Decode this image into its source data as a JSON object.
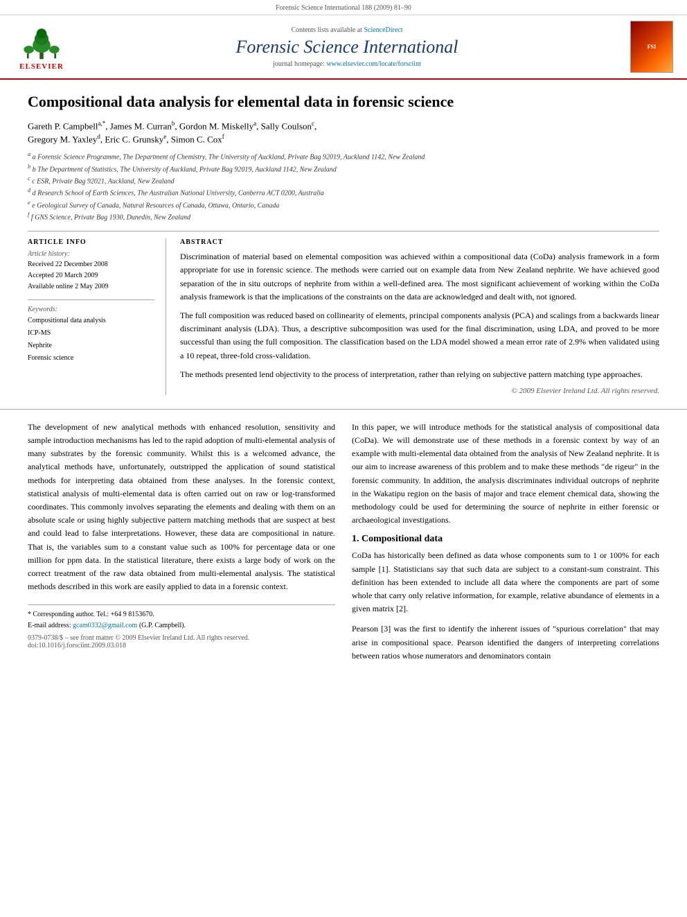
{
  "header_bar": {
    "text": "Forensic Science International 188 (2009) 81–90"
  },
  "journal_top": {
    "sciencedirect_text": "Contents lists available at ",
    "sciencedirect_link": "ScienceDirect",
    "title": "Forensic Science International",
    "homepage_text": "journal homepage: ",
    "homepage_link": "www.elsevier.com/locate/forsciint",
    "elsevier_label": "ELSEVIER"
  },
  "article": {
    "title": "Compositional data analysis for elemental data in forensic science",
    "authors": "Gareth P. Campbell",
    "authors_full": "Gareth P. Campbell a,*, James M. Curran b, Gordon M. Miskelly a, Sally Coulson c, Gregory M. Yaxley d, Eric C. Grunsky e, Simon C. Cox f",
    "affiliations": [
      "a Forensic Science Programme, The Department of Chemistry, The University of Auckland, Private Bag 92019, Auckland 1142, New Zealand",
      "b The Department of Statistics, The University of Auckland, Private Bag 92019, Auckland 1142, New Zealand",
      "c ESR, Private Bag 92021, Auckland, New Zealand",
      "d Research School of Earth Sciences, The Australian National University, Canberra ACT 0200, Australia",
      "e Geological Survey of Canada, Natural Resources of Canada, Ottawa, Ontario, Canada",
      "f GNS Science, Private Bag 1930, Dunedin, New Zealand"
    ]
  },
  "article_info": {
    "heading": "ARTICLE INFO",
    "history_label": "Article history:",
    "received": "Received 22 December 2008",
    "accepted": "Accepted 20 March 2009",
    "available": "Available online 2 May 2009",
    "keywords_label": "Keywords:",
    "keywords": [
      "Compositional data analysis",
      "ICP-MS",
      "Nephrite",
      "Forensic science"
    ]
  },
  "abstract": {
    "heading": "ABSTRACT",
    "para1": "Discrimination of material based on elemental composition was achieved within a compositional data (CoDa) analysis framework in a form appropriate for use in forensic science. The methods were carried out on example data from New Zealand nephrite. We have achieved good separation of the in situ outcrops of nephrite from within a well-defined area. The most significant achievement of working within the CoDa analysis framework is that the implications of the constraints on the data are acknowledged and dealt with, not ignored.",
    "para2": "The full composition was reduced based on collinearity of elements, principal components analysis (PCA) and scalings from a backwards linear discriminant analysis (LDA). Thus, a descriptive subcomposition was used for the final discrimination, using LDA, and proved to be more successful than using the full composition. The classification based on the LDA model showed a mean error rate of 2.9% when validated using a 10 repeat, three-fold cross-validation.",
    "para3": "The methods presented lend objectivity to the process of interpretation, rather than relying on subjective pattern matching type approaches.",
    "copyright": "© 2009 Elsevier Ireland Ltd. All rights reserved."
  },
  "body": {
    "col_left": {
      "para1": "The development of new analytical methods with enhanced resolution, sensitivity and sample introduction mechanisms has led to the rapid adoption of multi-elemental analysis of many substrates by the forensic community. Whilst this is a welcomed advance, the analytical methods have, unfortunately, outstripped the application of sound statistical methods for interpreting data obtained from these analyses. In the forensic context, statistical analysis of multi-elemental data is often carried out on raw or log-transformed coordinates. This commonly involves separating the elements and dealing with them on an absolute scale or using highly subjective pattern matching methods that are suspect at best and could lead to false interpretations. However, these data are compositional in nature. That is, the variables sum to a constant value such as 100% for percentage data or one million for ppm data. In the statistical literature, there exists a large body of work on the correct treatment of the raw data obtained from multi-elemental analysis. The statistical methods described in this work are easily applied to data in a forensic context."
    },
    "col_right": {
      "para1": "In this paper, we will introduce methods for the statistical analysis of compositional data (CoDa). We will demonstrate use of these methods in a forensic context by way of an example with multi-elemental data obtained from the analysis of New Zealand nephrite. It is our aim to increase awareness of this problem and to make these methods \"de rigeur\" in the forensic community. In addition, the analysis discriminates individual outcrops of nephrite in the Wakatipu region on the basis of major and trace element chemical data, showing the methodology could be used for determining the source of nephrite in either forensic or archaeological investigations.",
      "section1_title": "1. Compositional data",
      "section1_para1": "CoDa has historically been defined as data whose components sum to 1 or 100% for each sample [1]. Statisticians say that such data are subject to a constant-sum constraint. This definition has been extended to include all data where the components are part of some whole that carry only relative information, for example, relative abundance of elements in a given matrix [2].",
      "section1_para2": "Pearson [3] was the first to identify the inherent issues of \"spurious correlation\" that may arise in compositional space. Pearson identified the dangers of interpreting correlations between ratios whose numerators and denominators contain"
    }
  },
  "footnote": {
    "corresponding": "* Corresponding author. Tel.: +64 9 8153670.",
    "email_label": "E-mail address: ",
    "email": "gcam0332@gmail.com",
    "email_name": "(G.P. Campbell).",
    "issn": "0379-0738/$ – see front matter © 2009 Elsevier Ireland Ltd. All rights reserved.",
    "doi": "doi:10.1016/j.forsciint.2009.03.018"
  }
}
